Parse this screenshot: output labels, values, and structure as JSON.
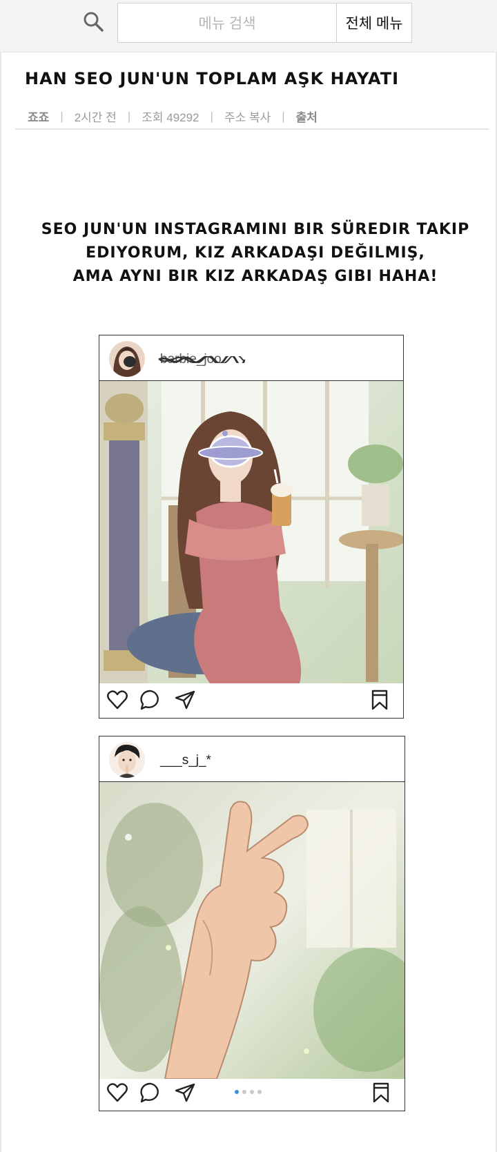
{
  "search": {
    "placeholder": "메뉴 검색",
    "menu_button": "전체 메뉴"
  },
  "post": {
    "title": "HAN SEO JUN'UN TOPLAM AŞK HAYATI",
    "author": "죠죠",
    "time": "2시간 전",
    "views": "조회 49292",
    "copy_link": "주소 복사",
    "source": "출처",
    "separator": "|"
  },
  "caption": {
    "lines": [
      "SEO JUN'UN INSTAGRAMINI BIR SÜREDIR TAKIP",
      "EDIYORUM, KIZ ARKADAŞI DEĞILMIŞ,",
      "AMA AYNI BIR KIZ ARKADAŞ GIBI HAHA!"
    ]
  },
  "instagram_posts": [
    {
      "username": "barbie_joo",
      "username_scribbled": true,
      "photo": "woman-in-pink-dress-with-frappe",
      "actions": [
        "heart-icon",
        "comment-icon",
        "share-icon",
        "bookmark-icon"
      ]
    },
    {
      "username": "___s_j_*",
      "username_scribbled": false,
      "photo": "finger-heart-hand-gesture",
      "actions": [
        "heart-icon",
        "comment-icon",
        "share-icon",
        "bookmark-icon"
      ],
      "carousel": {
        "count": 4,
        "active": 1
      }
    }
  ],
  "colors": {
    "top_bar": "#f4f4f4",
    "carousel_active": "#3b8fe0",
    "dress_pink": "#c97a7a"
  }
}
